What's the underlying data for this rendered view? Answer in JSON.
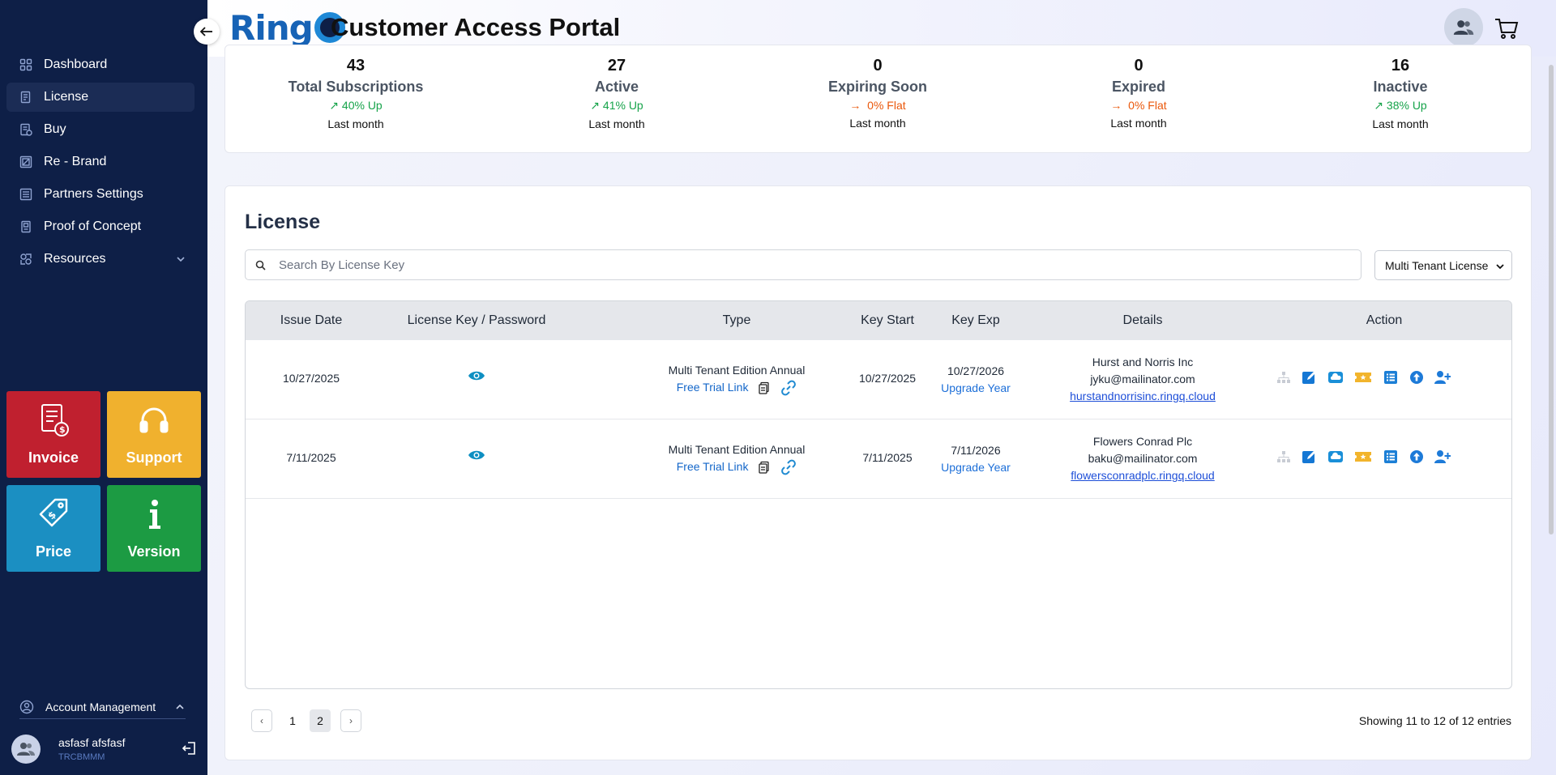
{
  "header": {
    "logo_text": "Ring",
    "title": "Customer Access Portal",
    "user_icon": "users-icon",
    "cart_icon": "cart-icon"
  },
  "sidebar": {
    "items": [
      {
        "label": "Dashboard",
        "icon": "grid-icon"
      },
      {
        "label": "License",
        "icon": "license-icon"
      },
      {
        "label": "Buy",
        "icon": "receipt-icon"
      },
      {
        "label": "Re - Brand",
        "icon": "brand-icon"
      },
      {
        "label": "Partners Settings",
        "icon": "list-icon"
      },
      {
        "label": "Proof of Concept",
        "icon": "document-icon"
      },
      {
        "label": "Resources",
        "icon": "resources-icon"
      }
    ],
    "tiles": [
      {
        "label": "Invoice",
        "color": "#c0202f",
        "icon": "invoice-icon"
      },
      {
        "label": "Support",
        "color": "#f0b12e",
        "icon": "headset-icon"
      },
      {
        "label": "Price",
        "color": "#1b8fc2",
        "icon": "price-tag-icon"
      },
      {
        "label": "Version",
        "color": "#1c9b43",
        "icon": "info-icon"
      }
    ],
    "account": {
      "label": "Account Management"
    },
    "user": {
      "name": "asfasf afsfasf",
      "id": "TRCBMMM"
    }
  },
  "stats": [
    {
      "value": "43",
      "label": "Total Subscriptions",
      "trend": "40% Up",
      "direction": "up",
      "period": "Last month"
    },
    {
      "value": "27",
      "label": "Active",
      "trend": "41% Up",
      "direction": "up",
      "period": "Last month"
    },
    {
      "value": "0",
      "label": "Expiring Soon",
      "trend": "0% Flat",
      "direction": "flat",
      "period": "Last month"
    },
    {
      "value": "0",
      "label": "Expired",
      "trend": "0% Flat",
      "direction": "flat",
      "period": "Last month"
    },
    {
      "value": "16",
      "label": "Inactive",
      "trend": "38% Up",
      "direction": "up",
      "period": "Last month"
    }
  ],
  "license": {
    "title": "License",
    "search_placeholder": "Search By License Key",
    "filter_selected": "Multi Tenant License",
    "columns": [
      "Issue Date",
      "License Key / Password",
      "Type",
      "Key Start",
      "Key Exp",
      "Details",
      "Action"
    ],
    "rows": [
      {
        "issue_date": "10/27/2025",
        "type": "Multi Tenant Edition Annual",
        "trial_link": "Free Trial Link",
        "key_start": "10/27/2025",
        "key_exp": "10/27/2026",
        "upgrade": "Upgrade Year",
        "company": "Hurst and Norris Inc",
        "email": "jyku@mailinator.com",
        "domain": "hurstandnorrisinc.ringq.cloud"
      },
      {
        "issue_date": "7/11/2025",
        "type": "Multi Tenant Edition Annual",
        "trial_link": "Free Trial Link",
        "key_start": "7/11/2025",
        "key_exp": "7/11/2026",
        "upgrade": "Upgrade Year",
        "company": "Flowers Conrad Plc",
        "email": "baku@mailinator.com",
        "domain": "flowersconradplc.ringq.cloud"
      }
    ],
    "pagination": {
      "prev": "‹",
      "next": "›",
      "pages": [
        "1",
        "2"
      ],
      "current": "2",
      "summary": "Showing 11 to 12 of 12 entries"
    }
  },
  "colors": {
    "sidebar_bg": "#0e1f47",
    "up": "#16a34a",
    "flat": "#ea580c",
    "link": "#1d4ed8"
  }
}
